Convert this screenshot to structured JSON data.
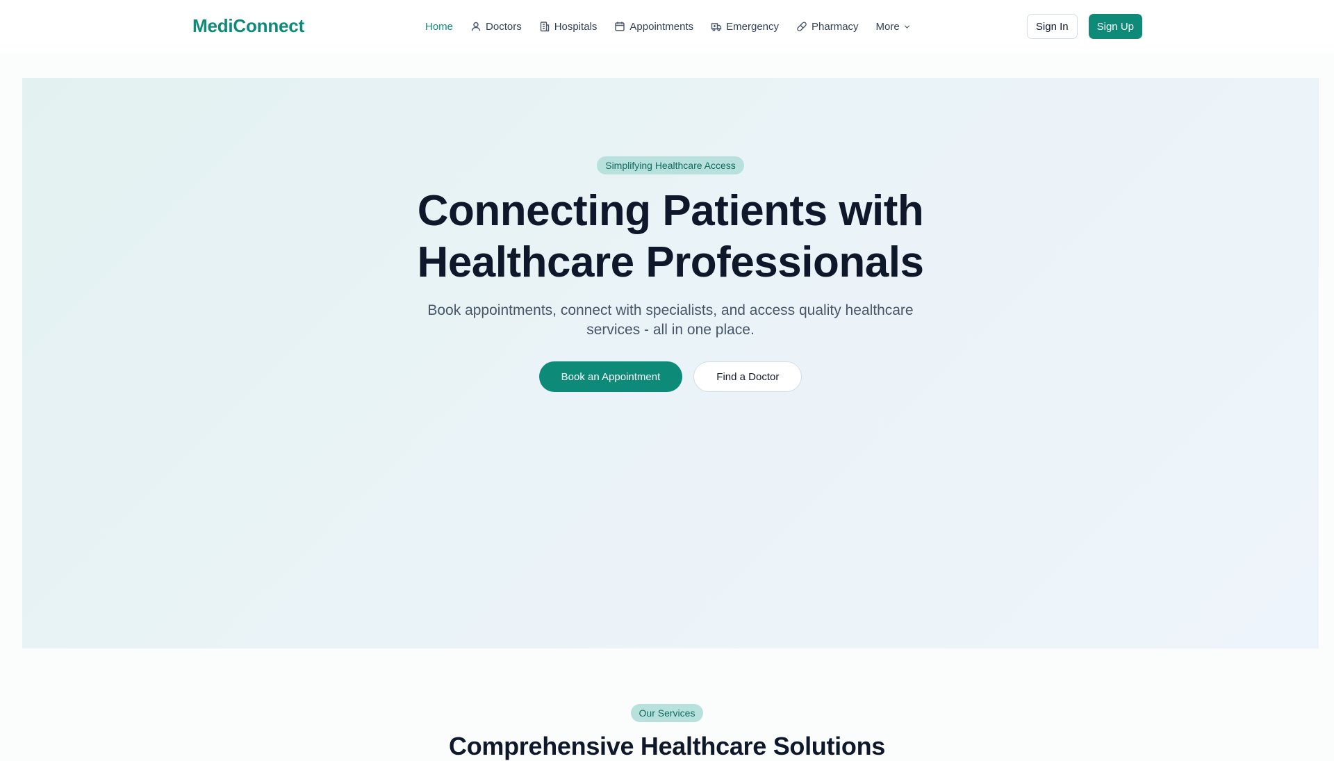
{
  "brand": {
    "name": "MediConnect",
    "color": "#0d8a78"
  },
  "nav": {
    "items": [
      {
        "label": "Home",
        "icon": "",
        "active": true
      },
      {
        "label": "Doctors",
        "icon": "user-icon"
      },
      {
        "label": "Hospitals",
        "icon": "building-icon"
      },
      {
        "label": "Appointments",
        "icon": "calendar-icon"
      },
      {
        "label": "Emergency",
        "icon": "ambulance-icon"
      },
      {
        "label": "Pharmacy",
        "icon": "pill-icon"
      },
      {
        "label": "More",
        "icon": "chevron-down-icon"
      }
    ]
  },
  "auth": {
    "sign_in": "Sign In",
    "sign_up": "Sign Up"
  },
  "hero": {
    "badge": "Simplifying Healthcare Access",
    "title_line1": "Connecting Patients with",
    "title_line2": "Healthcare Professionals",
    "subtitle": "Book appointments, connect with specialists, and access quality healthcare services - all in one place.",
    "primary_cta": "Book an Appointment",
    "secondary_cta": "Find a Doctor"
  },
  "services": {
    "badge": "Our Services",
    "title": "Comprehensive Healthcare Solutions"
  }
}
